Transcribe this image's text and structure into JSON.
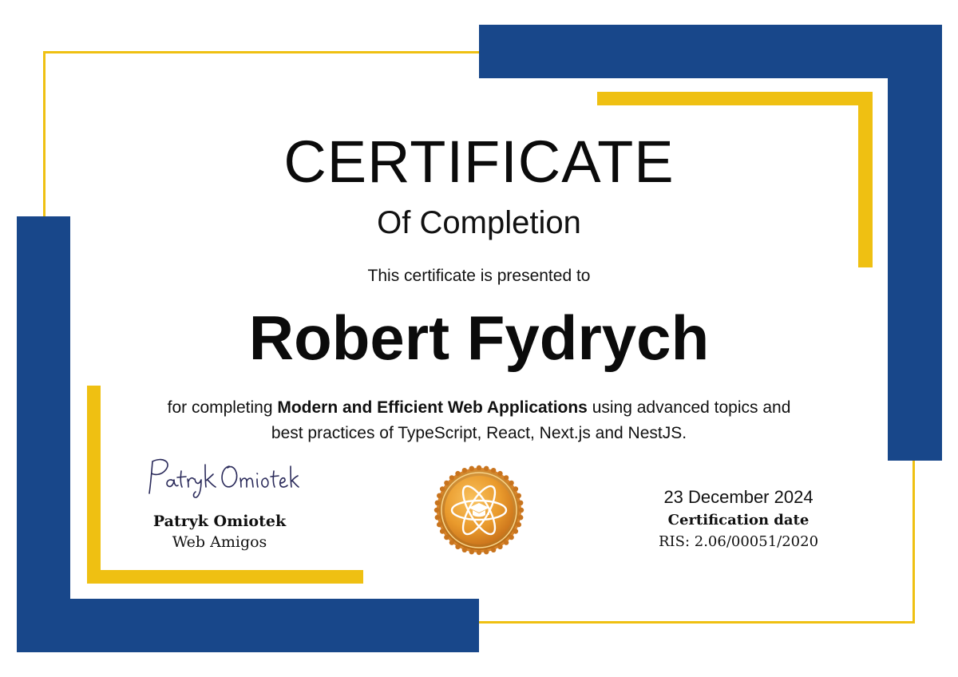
{
  "certificate": {
    "title": "CERTIFICATE",
    "subtitle": "Of Completion",
    "presented_text": "This certificate is presented to",
    "recipient_name": "Robert Fydrych",
    "description": {
      "prefix": "for completing ",
      "course": "Modern and Efficient Web Applications",
      "suffix": " using advanced topics and best practices of TypeScript, React, Next.js and NestJS."
    },
    "signer": {
      "signature_text": "Patryk Omiotek",
      "name": "Patryk Omiotek",
      "organization": "Web Amigos"
    },
    "date": {
      "value": "23 December 2024",
      "label": "Certification date",
      "ris": "RIS: 2.06/00051/2020"
    }
  },
  "colors": {
    "blue": "#18478a",
    "yellow": "#efc012",
    "badge_gold": "#e39a2a"
  },
  "icons": {
    "badge": "react-atom-graduation-badge-icon"
  }
}
